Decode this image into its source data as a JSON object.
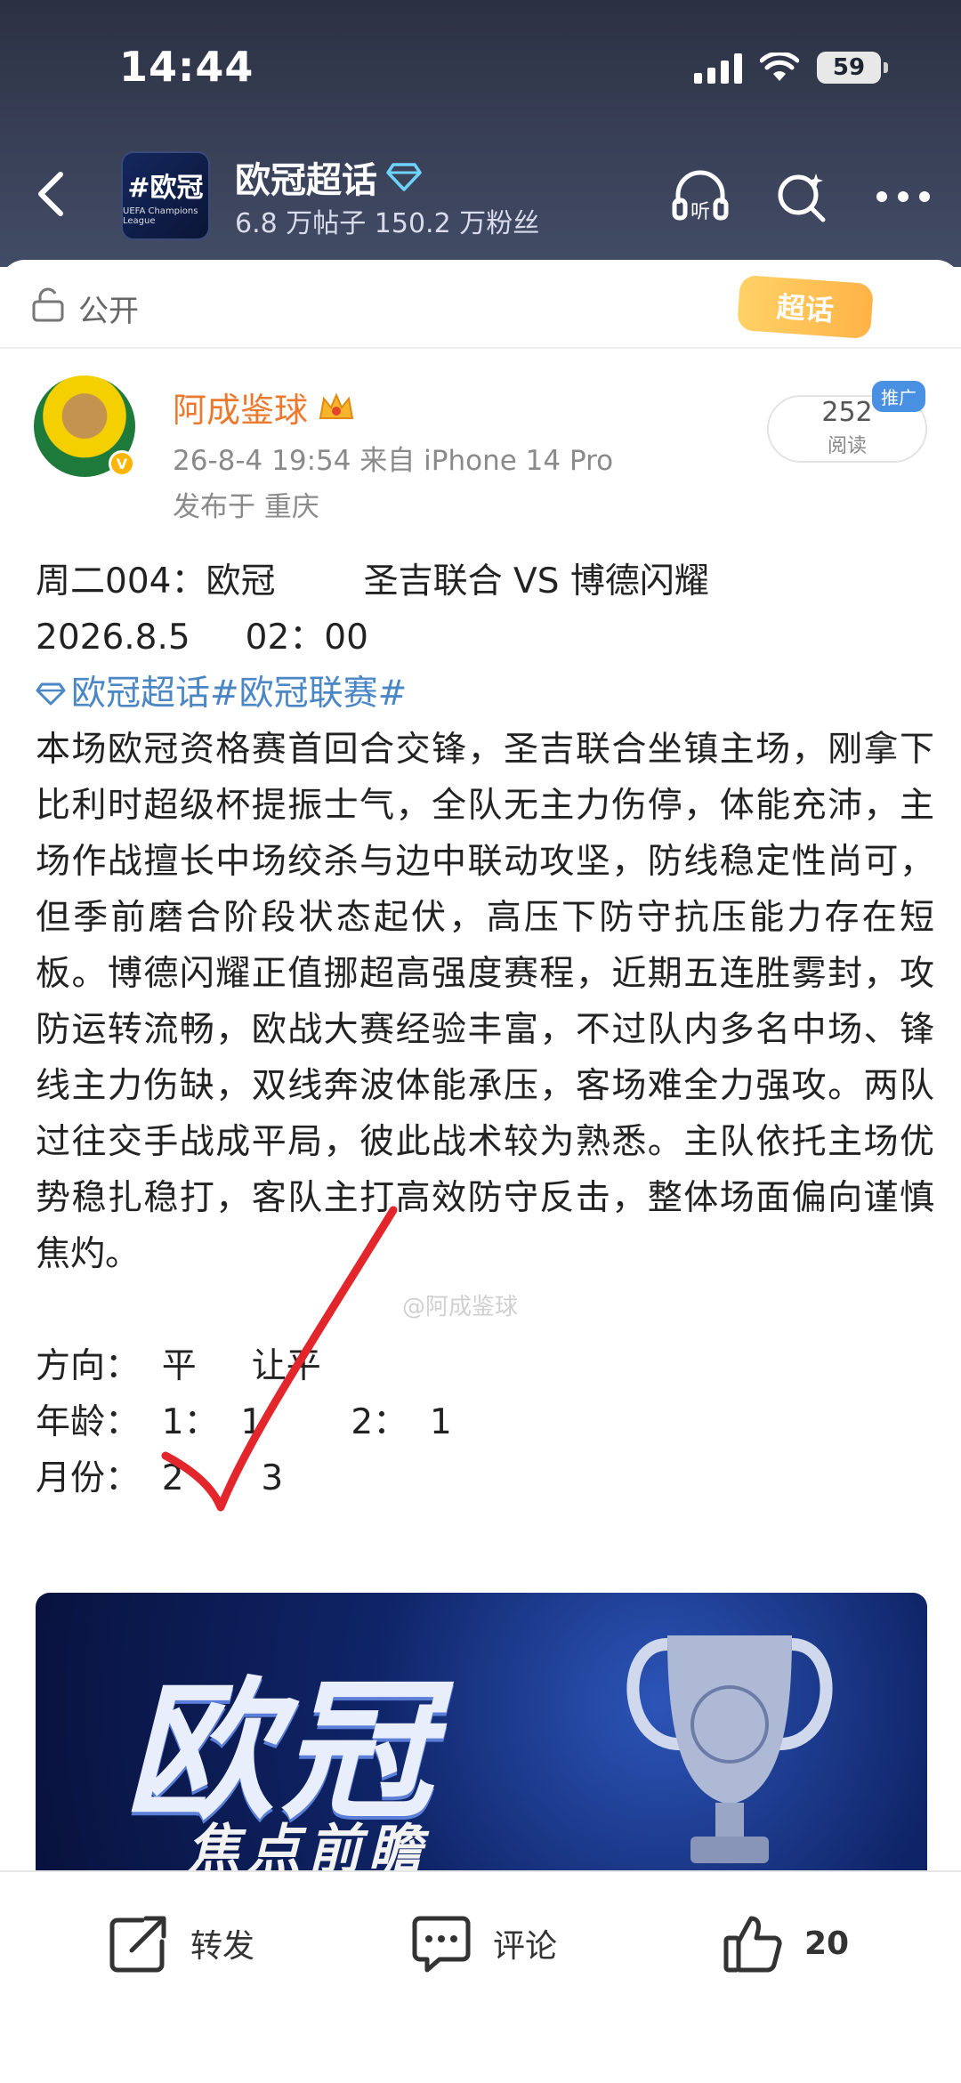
{
  "status": {
    "time": "14:44",
    "battery": "59"
  },
  "topic": {
    "logo_text": "#欧冠",
    "logo_sub": "UEFA Champions League",
    "name": "欧冠超话",
    "stats": "6.8 万帖子 150.2 万粉丝"
  },
  "visibility": {
    "label": "公开"
  },
  "badge": {
    "label": "超话"
  },
  "author": {
    "name": "阿成鉴球",
    "meta": "26-8-4 19:54  来自 iPhone 14 Pro",
    "location": "发布于 重庆"
  },
  "reads": {
    "count": "252",
    "label": "阅读",
    "promo": "推广"
  },
  "post": {
    "line1": "周二004：欧冠        圣吉联合 VS 博德闪耀",
    "line2": "2026.8.5     02：00",
    "hashtags": "欧冠超话#欧冠联赛#",
    "body": "本场欧冠资格赛首回合交锋，圣吉联合坐镇主场，刚拿下比利时超级杯提振士气，全队无主力伤停，体能充沛，主场作战擅长中场绞杀与边中联动攻坚，防线稳定性尚可，但季前磨合阶段状态起伏，高压下防守抗压能力存在短板。博德闪耀正值挪超高强度赛程，近期五连胜雾封，攻防运转流畅，欧战大赛经验丰富，不过队内多名中场、锋线主力伤缺，双线奔波体能承压，客场难全力强攻。两队过往交手战成平局，彼此战术较为熟悉。主队依托主场优势稳扎稳打，客队主打高效防守反击，整体场面偏向谨慎焦灼。",
    "direction": "方向：  平     让平",
    "age": "年龄：  1：  1        2：  1",
    "month": "月份：  2       3"
  },
  "watermark": "@阿成鉴球",
  "banner": {
    "title": "欧冠",
    "subtitle": "焦点前瞻"
  },
  "actions": {
    "repost": "转发",
    "comment": "评论",
    "like_count": "20"
  },
  "colors": {
    "accent_orange": "#eb7a2f",
    "link_blue": "#4b86c5",
    "header_bg": "#343b50"
  }
}
